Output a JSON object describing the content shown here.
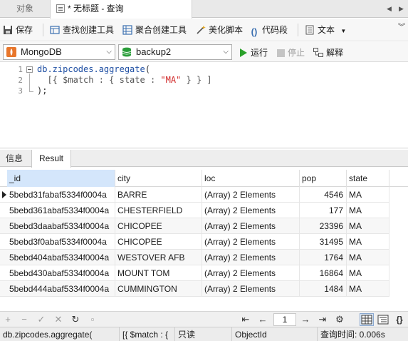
{
  "tabs": {
    "objects_label": "对象",
    "query_label": "* 无标题 - 查询"
  },
  "toolbar": {
    "save_label": "保存",
    "find_builder_label": "查找创建工具",
    "aggregate_builder_label": "聚合创建工具",
    "beautify_label": "美化脚本",
    "snippet_label": "代码段",
    "text_label": "文本"
  },
  "selectors": {
    "connection": "MongoDB",
    "database": "backup2",
    "run_label": "运行",
    "stop_label": "停止",
    "explain_label": "解释"
  },
  "editor": {
    "line_numbers": [
      "1",
      "2",
      "3"
    ],
    "line1": {
      "obj": "db.zipcodes.aggregate",
      "punct": "("
    },
    "line2": {
      "pre": "  [{ $match : { state : ",
      "str": "\"MA\"",
      "post": " } } ]"
    },
    "line3": {
      "text": ");"
    }
  },
  "result_tabs": {
    "info_label": "信息",
    "result_label": "Result"
  },
  "grid": {
    "columns": [
      "_id",
      "city",
      "loc",
      "pop",
      "state"
    ],
    "rows": [
      [
        "5bebd31fabaf5334f0004a",
        "BARRE",
        "(Array) 2 Elements",
        "4546",
        "MA"
      ],
      [
        "5bebd361abaf5334f0004a",
        "CHESTERFIELD",
        "(Array) 2 Elements",
        "177",
        "MA"
      ],
      [
        "5bebd3daabaf5334f0004a",
        "CHICOPEE",
        "(Array) 2 Elements",
        "23396",
        "MA"
      ],
      [
        "5bebd3f0abaf5334f0004a",
        "CHICOPEE",
        "(Array) 2 Elements",
        "31495",
        "MA"
      ],
      [
        "5bebd404abaf5334f0004a",
        "WESTOVER AFB",
        "(Array) 2 Elements",
        "1764",
        "MA"
      ],
      [
        "5bebd430abaf5334f0004a",
        "MOUNT TOM",
        "(Array) 2 Elements",
        "16864",
        "MA"
      ],
      [
        "5bebd444abaf5334f0004a",
        "CUMMINGTON",
        "(Array) 2 Elements",
        "1484",
        "MA"
      ]
    ]
  },
  "navbar": {
    "page": "1"
  },
  "statusbar": {
    "query_snippet": "db.zipcodes.aggregate(",
    "match_snippet": "[{ $match : {",
    "readonly": "只读",
    "type": "ObjectId",
    "query_time": "查询时间: 0.006s"
  },
  "colors": {
    "accent": "#d4e6fb",
    "run_green": "#2aa02a",
    "string_red": "#d12828",
    "code_blue": "#1f4fa3"
  }
}
